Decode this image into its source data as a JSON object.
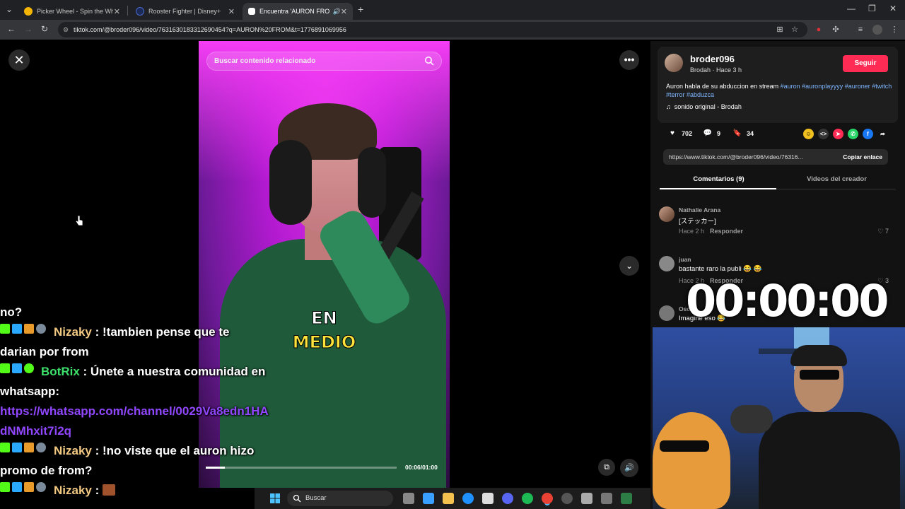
{
  "browser": {
    "tabs": [
      {
        "title": "Picker Wheel - Spin the Wheel",
        "active": false,
        "color": "#f5b400"
      },
      {
        "title": "Rooster Fighter | Disney+",
        "active": false,
        "color": "#1b2a57"
      },
      {
        "title": "Encuentra 'AURON FROM'",
        "active": true,
        "color": "#ffffff"
      }
    ],
    "url": "tiktok.com/@broder096/video/7631630183312690454?q=AURON%20FROM&t=1776891069956"
  },
  "video": {
    "search_placeholder": "Buscar contenido relacionado",
    "caption_line1": "EN",
    "caption_line2": "MEDIO",
    "timecode": "00:06/01:00",
    "progress": 0.1
  },
  "post": {
    "username": "broder096",
    "subline": "Brodah · Hace 3 h",
    "follow_label": "Seguir",
    "description": "Auron habla de su abduccion en stream",
    "hashtags": [
      "#auron",
      "#auronplayyyy",
      "#auroner",
      "#twitch",
      "#terror",
      "#abduzca"
    ],
    "sound": "sonido original - Brodah",
    "likes": "702",
    "comments": "9",
    "saves": "34",
    "link": "https://www.tiktok.com/@broder096/video/76316...",
    "copy_label": "Copiar enlace",
    "tab_comments": "Comentarios (9)",
    "tab_videos": "Videos del creador"
  },
  "comments": [
    {
      "name": "Nathalie Arana",
      "text": "[ステッカー]",
      "time": "Hace 2 h",
      "reply": "Responder",
      "likes": "7"
    },
    {
      "name": "juan",
      "text": "bastante raro la publi 😂 😂",
      "time": "Hace 2 h",
      "reply": "Responder",
      "likes": "3"
    },
    {
      "name": "Osc",
      "text": "Imagine eso 😂",
      "time": "",
      "reply": "",
      "likes": ""
    }
  ],
  "timer": "00:00:00",
  "chat": [
    {
      "user": "",
      "text": "no?",
      "type": "cont"
    },
    {
      "user": "Nizaky",
      "text": ": !tambien pense que te darian por from",
      "type": "nizaky"
    },
    {
      "user": "BotRix",
      "text": ": Únete a nuestra comunidad en whatsapp:",
      "type": "botrix"
    },
    {
      "user": "",
      "text": "https://whatsapp.com/channel/0029Va8edn1HAdNMhxit7i2q",
      "type": "link"
    },
    {
      "user": "Nizaky",
      "text": ": !no viste que el auron hizo promo de from?",
      "type": "nizaky"
    },
    {
      "user": "Nizaky",
      "text": ":",
      "type": "nizaky"
    }
  ],
  "taskbar": {
    "search_label": "Buscar"
  }
}
